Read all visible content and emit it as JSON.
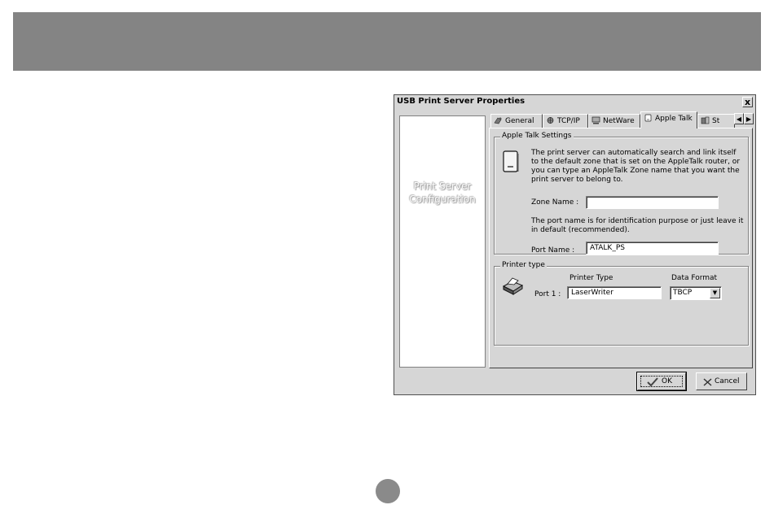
{
  "window": {
    "title": "USB Print Server Properties",
    "close_label": "x"
  },
  "sidebar": {
    "line1": "Print Server",
    "line2": "Configuration"
  },
  "tabs": [
    {
      "label": "General",
      "icon": "general-icon"
    },
    {
      "label": "TCP/IP",
      "icon": "tcpip-icon"
    },
    {
      "label": "NetWare",
      "icon": "netware-icon"
    },
    {
      "label": "Apple Talk",
      "icon": "appletalk-icon",
      "active": true
    },
    {
      "label": "St",
      "icon": "status-icon"
    }
  ],
  "scroll": {
    "left": "◀",
    "right": "▶"
  },
  "appletalk": {
    "group_title": "Apple Talk Settings",
    "description": "The print server can automatically search and link itself to the default zone that is set on the AppleTalk router, or you can type an AppleTalk Zone name that you want the print server to belong to.",
    "zone_label": "Zone Name :",
    "zone_value": "",
    "port_note": "The port name is for identification purpose or just leave it in default (recommended).",
    "port_label": "Port Name :",
    "port_value": "ATALK_PS"
  },
  "printer": {
    "group_title": "Printer type",
    "col_type": "Printer Type",
    "col_format": "Data Format",
    "port_label": "Port 1 :",
    "type_value": "LaserWriter",
    "format_value": "TBCP"
  },
  "buttons": {
    "ok": "OK",
    "cancel": "Cancel"
  },
  "colors": {
    "header_band": "#848484",
    "dialog_face": "#d6d6d6"
  }
}
